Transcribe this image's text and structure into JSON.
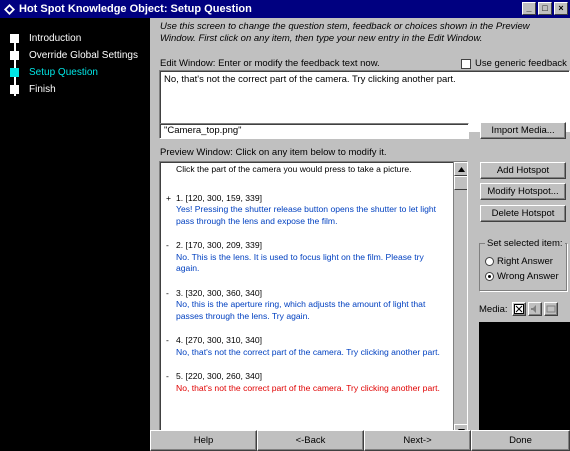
{
  "window": {
    "title": "Hot Spot Knowledge Object: Setup Question",
    "icon": "diamond-app-icon",
    "controls": {
      "minimize": "_",
      "maximize": "□",
      "close": "×"
    }
  },
  "sidebar": {
    "steps": [
      {
        "label": "Introduction",
        "active": false
      },
      {
        "label": "Override Global Settings",
        "active": false
      },
      {
        "label": "Setup Question",
        "active": true
      },
      {
        "label": "Finish",
        "active": false
      }
    ]
  },
  "instructions": "Use this screen to change the question stem, feedback or choices shown in the Preview Window. First click on any item, then type your new entry in the Edit Window.",
  "edit_window": {
    "label": "Edit Window: Enter or modify the feedback text now.",
    "value": "No, that's not the correct part of the camera. Try clicking another part.",
    "generic_feedback_label": "Use generic feedback",
    "generic_feedback_checked": false
  },
  "media": {
    "filename": "\"Camera_top.png\"",
    "import_button": "Import Media..."
  },
  "preview": {
    "label": "Preview Window: Click on any item below to modify it.",
    "question": "Click the part of the camera you would press to take a picture.",
    "items": [
      {
        "mark": "+",
        "coords": "1. [120, 300, 159, 339]",
        "feedback": "Yes! Pressing the shutter release button opens the shutter to let light pass through the lens and expose the film.",
        "selected": false
      },
      {
        "mark": "-",
        "coords": "2. [170, 300, 209, 339]",
        "feedback": "No. This is the lens. It is used to focus light on the film. Please try again.",
        "selected": false
      },
      {
        "mark": "-",
        "coords": "3. [320, 300, 360, 340]",
        "feedback": "No, this is the aperture ring, which adjusts the amount of light that passes through the lens. Try again.",
        "selected": false
      },
      {
        "mark": "-",
        "coords": "4. [270, 300, 310, 340]",
        "feedback": "No, that's not the correct part of the camera. Try clicking another part.",
        "selected": false
      },
      {
        "mark": "-",
        "coords": "5. [220, 300, 260, 340]",
        "feedback": "No, that's not the correct part of the camera. Try clicking another part.",
        "selected": true
      }
    ]
  },
  "hotspot_buttons": {
    "add": "Add Hotspot",
    "modify": "Modify Hotspot...",
    "delete": "Delete Hotspot"
  },
  "set_item": {
    "title": "Set selected item:",
    "right": "Right Answer",
    "wrong": "Wrong Answer",
    "selected": "wrong"
  },
  "media_controls": {
    "label": "Media:",
    "buttons": [
      "film-icon",
      "speaker-icon",
      "clip-icon"
    ]
  },
  "nav": {
    "help": "Help",
    "back": "<-Back",
    "next": "Next->",
    "done": "Done"
  }
}
